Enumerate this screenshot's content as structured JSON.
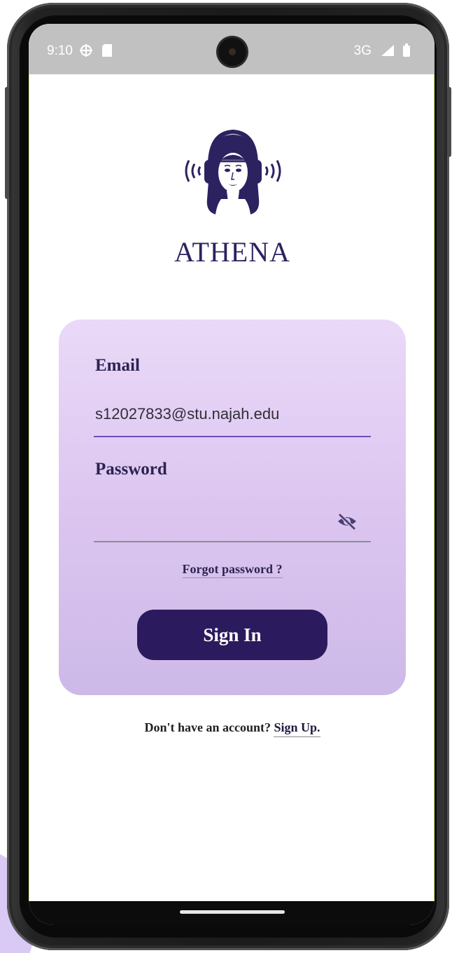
{
  "status_bar": {
    "time": "9:10",
    "network": "3G",
    "icons": [
      "location-icon",
      "sd-card-icon",
      "signal-icon",
      "battery-icon"
    ]
  },
  "app": {
    "brand_name": "ATHENA",
    "logo": "athena-headphones-logo"
  },
  "login_form": {
    "email_label": "Email",
    "email_value": "s12027833@stu.najah.edu",
    "password_label": "Password",
    "password_value": "",
    "password_toggle_icon": "eye-off-icon",
    "forgot_password": "Forgot password ?",
    "sign_in_label": "Sign In"
  },
  "footer": {
    "prompt": "Don't have an account?",
    "sign_up": "Sign Up."
  },
  "colors": {
    "primary": "#2c1a5e",
    "brand_text": "#2d2260",
    "card_top": "#ead9f8",
    "card_bottom": "#cdb9e8",
    "email_underline": "#6a4fb5"
  }
}
